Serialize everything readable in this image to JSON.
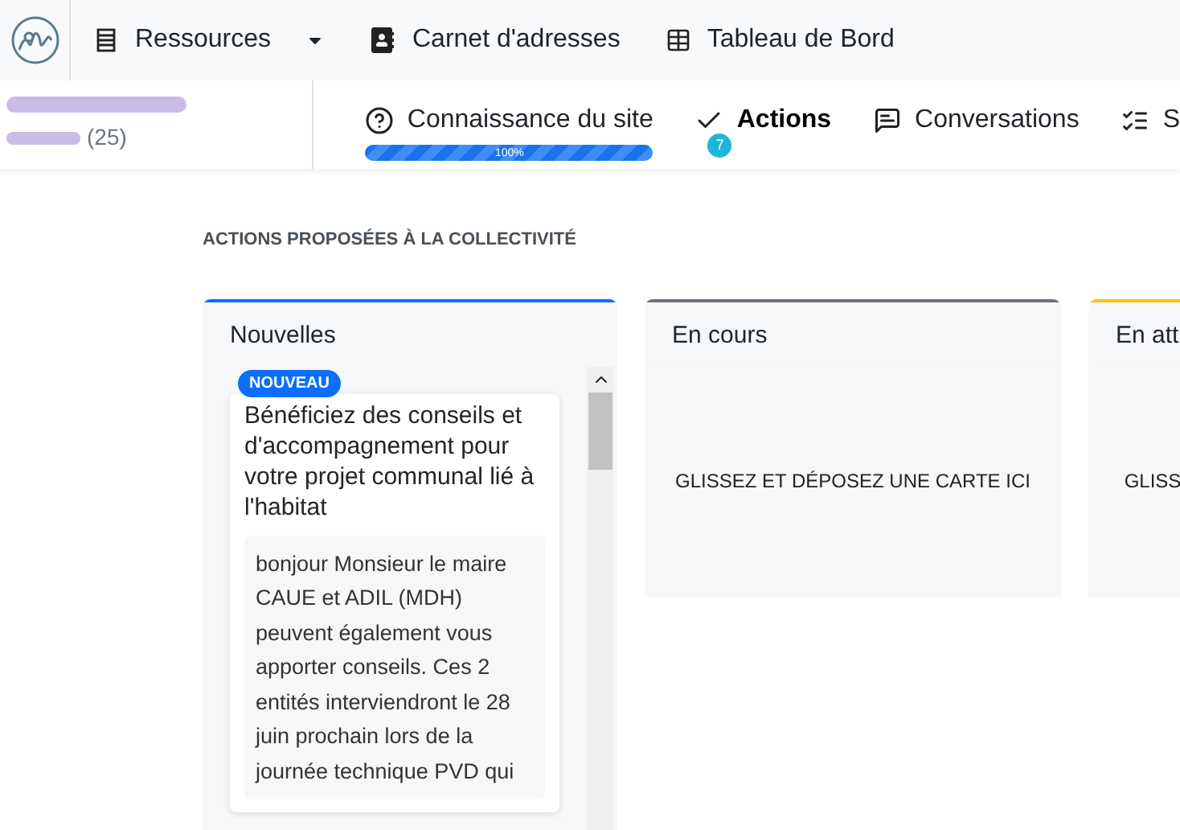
{
  "navbar": {
    "items": [
      {
        "kind": "dropdown",
        "label": "Ressources"
      },
      {
        "kind": "link",
        "label": "Carnet d'adresses"
      },
      {
        "kind": "link",
        "label": "Tableau de Bord"
      }
    ]
  },
  "project": {
    "count": "(25)"
  },
  "tabs": [
    {
      "label": "Connaissance du site",
      "selected": false,
      "progress": {
        "level": 1,
        "label": "100%"
      }
    },
    {
      "label": "Actions",
      "selected": true,
      "badge": "7"
    },
    {
      "label": "Conversations",
      "selected": false
    },
    {
      "label": "S",
      "selected": false
    }
  ],
  "section_title": "ACTIONS PROPOSÉES À LA COLLECTIVITÉ",
  "columns": [
    {
      "title": "Nouvelles",
      "color": "#0d6efd",
      "cards": [
        {
          "badge": "NOUVEAU",
          "title": "Bénéficiez des conseils et d'accompagnement pour votre projet communal lié à l'habitat",
          "message": "bonjour Monsieur le maire CAUE et ADIL (MDH) peuvent également vous apporter conseils. Ces 2 entités interviendront le 28 juin prochain lors de la journée technique PVD qui"
        }
      ]
    },
    {
      "title": "En cours",
      "color": "#6c757d",
      "placeholder": "GLISSEZ ET DÉPOSEZ UNE CARTE ICI"
    },
    {
      "title": "En att",
      "color": "#ffc107",
      "placeholder": "GLISS"
    }
  ]
}
